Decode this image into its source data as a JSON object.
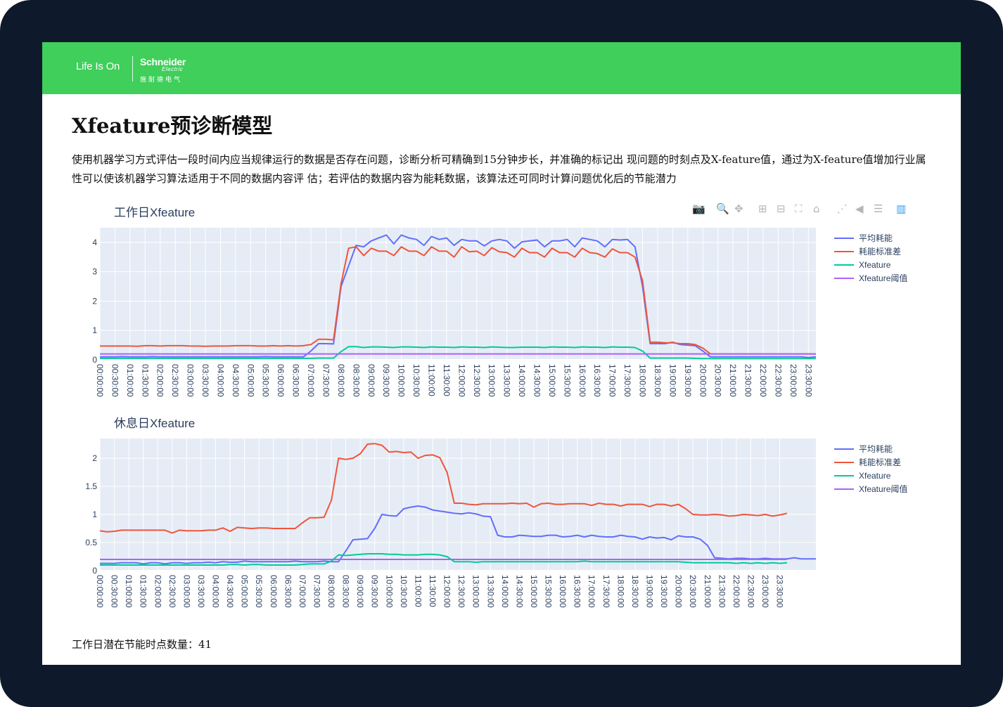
{
  "logo": {
    "tagline": "Life Is On",
    "brand": "Schneider",
    "brand_sub": "Electric",
    "brand_cn": "施耐德电气"
  },
  "page": {
    "title": "Xfeature预诊断模型",
    "description": "使用机器学习方式评估一段时间内应当规律运行的数据是否存在问题，诊断分析可精确到15分钟步长，并准确的标记出 现问题的时刻点及X-feature值，通过为X-feature值增加行业属性可以使该机器学习算法适用于不同的数据内容评 估；若评估的数据内容为能耗数据，该算法还可同时计算问题优化后的节能潜力",
    "footer_label": "工作日潜在节能时点数量：",
    "footer_value": "41"
  },
  "modebar": [
    {
      "icon": "camera-icon",
      "glyph": "📷"
    },
    {
      "icon": "zoom-icon",
      "glyph": "🔍"
    },
    {
      "icon": "pan-icon",
      "glyph": "✥"
    },
    {
      "icon": "zoom-in-icon",
      "glyph": "⊞"
    },
    {
      "icon": "zoom-out-icon",
      "glyph": "⊟"
    },
    {
      "icon": "autoscale-icon",
      "glyph": "⛶"
    },
    {
      "icon": "reset-axes-icon",
      "glyph": "⌂"
    },
    {
      "icon": "spike-lines-icon",
      "glyph": "⋰"
    },
    {
      "icon": "hover-closest-icon",
      "glyph": "◀"
    },
    {
      "icon": "hover-compare-icon",
      "glyph": "☰"
    },
    {
      "icon": "plotly-logo-icon",
      "glyph": "▥"
    }
  ],
  "colors": {
    "avg": "#636efa",
    "std": "#ef553b",
    "xfeature": "#00cc96",
    "threshold": "#ab63fa",
    "plot_bg": "#e5ecf6",
    "banner": "#3fcf5a"
  },
  "chart_data": [
    {
      "type": "line",
      "title": "工作日Xfeature",
      "x_tick_labels": [
        "00:00:00",
        "00:30:00",
        "01:00:00",
        "01:30:00",
        "02:00:00",
        "02:30:00",
        "03:00:00",
        "03:30:00",
        "04:00:00",
        "04:30:00",
        "05:00:00",
        "05:30:00",
        "06:00:00",
        "06:30:00",
        "07:00:00",
        "07:30:00",
        "08:00:00",
        "08:30:00",
        "09:00:00",
        "09:30:00",
        "10:00:00",
        "10:30:00",
        "11:00:00",
        "11:30:00",
        "12:00:00",
        "12:30:00",
        "13:00:00",
        "13:30:00",
        "14:00:00",
        "14:30:00",
        "15:00:00",
        "15:30:00",
        "16:00:00",
        "16:30:00",
        "17:00:00",
        "17:30:00",
        "18:00:00",
        "18:30:00",
        "19:00:00",
        "19:30:00",
        "20:00:00",
        "20:30:00",
        "21:00:00",
        "21:30:00",
        "22:00:00",
        "22:30:00",
        "23:00:00",
        "23:30:00"
      ],
      "x_step_minutes": 15,
      "ylim": [
        0,
        4.5
      ],
      "y_ticks": [
        0,
        1,
        2,
        3,
        4
      ],
      "y_tick_labels": [
        "0",
        "1",
        "2",
        "3",
        "4"
      ],
      "legend_position": "right",
      "series": [
        {
          "name": "平均耗能",
          "color_key": "avg",
          "values": [
            0.1,
            0.1,
            0.1,
            0.11,
            0.1,
            0.1,
            0.1,
            0.11,
            0.1,
            0.1,
            0.1,
            0.1,
            0.1,
            0.1,
            0.1,
            0.1,
            0.1,
            0.1,
            0.1,
            0.1,
            0.1,
            0.1,
            0.11,
            0.1,
            0.1,
            0.1,
            0.1,
            0.1,
            0.3,
            0.55,
            0.55,
            0.54,
            2.5,
            3.2,
            3.9,
            3.85,
            4.05,
            4.15,
            4.25,
            3.95,
            4.25,
            4.15,
            4.1,
            3.9,
            4.2,
            4.1,
            4.15,
            3.9,
            4.1,
            4.05,
            4.05,
            3.88,
            4.05,
            4.1,
            4.05,
            3.8,
            4.02,
            4.05,
            4.08,
            3.85,
            4.05,
            4.05,
            4.1,
            3.85,
            4.15,
            4.1,
            4.05,
            3.85,
            4.1,
            4.08,
            4.1,
            3.85,
            2.5,
            0.55,
            0.55,
            0.55,
            0.6,
            0.52,
            0.5,
            0.48,
            0.3,
            0.1,
            0.1,
            0.1,
            0.1,
            0.1,
            0.1,
            0.1,
            0.1,
            0.1,
            0.1,
            0.1,
            0.1,
            0.1,
            0.08,
            0.1
          ]
        },
        {
          "name": "耗能标准差",
          "color_key": "std",
          "values": [
            0.47,
            0.47,
            0.47,
            0.47,
            0.47,
            0.46,
            0.48,
            0.48,
            0.47,
            0.48,
            0.48,
            0.48,
            0.47,
            0.47,
            0.46,
            0.47,
            0.47,
            0.47,
            0.48,
            0.48,
            0.48,
            0.47,
            0.47,
            0.48,
            0.47,
            0.48,
            0.47,
            0.48,
            0.52,
            0.7,
            0.7,
            0.68,
            2.6,
            3.8,
            3.85,
            3.55,
            3.8,
            3.7,
            3.7,
            3.55,
            3.85,
            3.7,
            3.7,
            3.55,
            3.85,
            3.7,
            3.7,
            3.5,
            3.85,
            3.68,
            3.7,
            3.55,
            3.82,
            3.68,
            3.65,
            3.5,
            3.8,
            3.65,
            3.65,
            3.5,
            3.8,
            3.65,
            3.65,
            3.5,
            3.8,
            3.65,
            3.62,
            3.5,
            3.78,
            3.65,
            3.65,
            3.5,
            2.7,
            0.6,
            0.6,
            0.58,
            0.58,
            0.55,
            0.55,
            0.52,
            0.4,
            0.2,
            0.2,
            0.2,
            0.2,
            0.2,
            0.2,
            0.2,
            0.2,
            0.2,
            0.2,
            0.2,
            0.2,
            0.2,
            0.2,
            0.2
          ]
        },
        {
          "name": "Xfeature",
          "color_key": "xfeature",
          "values": [
            0.05,
            0.05,
            0.05,
            0.05,
            0.05,
            0.05,
            0.05,
            0.05,
            0.05,
            0.05,
            0.05,
            0.05,
            0.05,
            0.05,
            0.05,
            0.05,
            0.05,
            0.05,
            0.05,
            0.05,
            0.05,
            0.05,
            0.05,
            0.05,
            0.05,
            0.05,
            0.05,
            0.05,
            0.05,
            0.06,
            0.06,
            0.06,
            0.28,
            0.45,
            0.45,
            0.42,
            0.44,
            0.44,
            0.43,
            0.42,
            0.44,
            0.44,
            0.43,
            0.42,
            0.44,
            0.43,
            0.43,
            0.42,
            0.44,
            0.43,
            0.43,
            0.42,
            0.44,
            0.43,
            0.42,
            0.42,
            0.43,
            0.43,
            0.43,
            0.42,
            0.44,
            0.43,
            0.43,
            0.42,
            0.44,
            0.43,
            0.43,
            0.42,
            0.44,
            0.43,
            0.43,
            0.42,
            0.3,
            0.06,
            0.06,
            0.06,
            0.06,
            0.06,
            0.06,
            0.05,
            0.04,
            0.04,
            0.04,
            0.04,
            0.04,
            0.04,
            0.04,
            0.04,
            0.04,
            0.04,
            0.04,
            0.04,
            0.04,
            0.04,
            0.04,
            0.04
          ]
        },
        {
          "name": "Xfeature阈值",
          "color_key": "threshold",
          "values": [
            0.2,
            0.2,
            0.2,
            0.2,
            0.2,
            0.2,
            0.2,
            0.2,
            0.2,
            0.2,
            0.2,
            0.2,
            0.2,
            0.2,
            0.2,
            0.2,
            0.2,
            0.2,
            0.2,
            0.2,
            0.2,
            0.2,
            0.2,
            0.2,
            0.2,
            0.2,
            0.2,
            0.2,
            0.2,
            0.2,
            0.2,
            0.2,
            0.2,
            0.2,
            0.2,
            0.2,
            0.2,
            0.2,
            0.2,
            0.2,
            0.2,
            0.2,
            0.2,
            0.2,
            0.2,
            0.2,
            0.2,
            0.2,
            0.2,
            0.2,
            0.2,
            0.2,
            0.2,
            0.2,
            0.2,
            0.2,
            0.2,
            0.2,
            0.2,
            0.2,
            0.2,
            0.2,
            0.2,
            0.2,
            0.2,
            0.2,
            0.2,
            0.2,
            0.2,
            0.2,
            0.2,
            0.2,
            0.2,
            0.2,
            0.2,
            0.2,
            0.2,
            0.2,
            0.2,
            0.2,
            0.2,
            0.2,
            0.2,
            0.2,
            0.2,
            0.2,
            0.2,
            0.2,
            0.2,
            0.2,
            0.2,
            0.2,
            0.2,
            0.2,
            0.2,
            0.2
          ]
        }
      ]
    },
    {
      "type": "line",
      "title": "休息日Xfeature",
      "x_tick_labels": [
        "00:00:00",
        "00:30:00",
        "01:00:00",
        "01:30:00",
        "02:00:00",
        "02:30:00",
        "03:00:00",
        "03:30:00",
        "04:00:00",
        "04:30:00",
        "05:00:00",
        "05:30:00",
        "06:00:00",
        "06:30:00",
        "07:00:00",
        "07:30:00",
        "08:00:00",
        "08:30:00",
        "09:00:00",
        "09:30:00",
        "10:00:00",
        "10:30:00",
        "11:00:00",
        "11:30:00",
        "12:00:00",
        "12:30:00",
        "13:00:00",
        "13:30:00",
        "14:00:00",
        "14:30:00",
        "15:00:00",
        "15:30:00",
        "16:00:00",
        "16:30:00",
        "17:00:00",
        "17:30:00",
        "18:00:00",
        "18:30:00",
        "19:00:00",
        "19:30:00",
        "20:00:00",
        "20:30:00",
        "21:00:00",
        "21:30:00",
        "22:00:00",
        "22:30:00",
        "23:00:00",
        "23:30:00"
      ],
      "x_step_minutes": 15,
      "ylim": [
        0,
        2.35
      ],
      "y_ticks": [
        0,
        0.5,
        1,
        1.5,
        2
      ],
      "y_tick_labels": [
        "0",
        "0.5",
        "1",
        "1.5",
        "2"
      ],
      "legend_position": "right",
      "series": [
        {
          "name": "平均耗能",
          "color_key": "avg",
          "values": [
            0.13,
            0.13,
            0.13,
            0.14,
            0.14,
            0.14,
            0.12,
            0.14,
            0.14,
            0.12,
            0.14,
            0.14,
            0.13,
            0.14,
            0.14,
            0.15,
            0.14,
            0.16,
            0.15,
            0.15,
            0.17,
            0.16,
            0.16,
            0.16,
            0.16,
            0.16,
            0.16,
            0.17,
            0.16,
            0.16,
            0.16,
            0.17,
            0.16,
            0.16,
            0.35,
            0.55,
            0.56,
            0.57,
            0.75,
            1.0,
            0.98,
            0.97,
            1.1,
            1.13,
            1.15,
            1.13,
            1.08,
            1.06,
            1.04,
            1.02,
            1.01,
            1.03,
            1.01,
            0.97,
            0.96,
            0.63,
            0.6,
            0.6,
            0.63,
            0.62,
            0.61,
            0.61,
            0.63,
            0.63,
            0.6,
            0.61,
            0.63,
            0.6,
            0.63,
            0.61,
            0.6,
            0.6,
            0.63,
            0.61,
            0.6,
            0.56,
            0.6,
            0.58,
            0.59,
            0.55,
            0.62,
            0.6,
            0.6,
            0.56,
            0.45,
            0.23,
            0.22,
            0.21,
            0.22,
            0.22,
            0.21,
            0.21,
            0.22,
            0.21,
            0.21,
            0.21,
            0.23,
            0.21,
            0.21,
            0.21
          ]
        },
        {
          "name": "耗能标准差",
          "color_key": "std",
          "values": [
            0.71,
            0.69,
            0.7,
            0.72,
            0.72,
            0.72,
            0.72,
            0.72,
            0.72,
            0.72,
            0.67,
            0.72,
            0.71,
            0.71,
            0.71,
            0.72,
            0.72,
            0.76,
            0.7,
            0.77,
            0.76,
            0.75,
            0.76,
            0.76,
            0.75,
            0.75,
            0.75,
            0.75,
            0.85,
            0.94,
            0.94,
            0.95,
            1.25,
            2.0,
            1.98,
            2.0,
            2.08,
            2.25,
            2.26,
            2.23,
            2.11,
            2.12,
            2.1,
            2.11,
            2.0,
            2.05,
            2.06,
            2.01,
            1.75,
            1.2,
            1.2,
            1.18,
            1.17,
            1.19,
            1.19,
            1.19,
            1.19,
            1.2,
            1.19,
            1.2,
            1.13,
            1.19,
            1.2,
            1.18,
            1.18,
            1.19,
            1.19,
            1.19,
            1.16,
            1.2,
            1.18,
            1.18,
            1.15,
            1.18,
            1.18,
            1.18,
            1.14,
            1.18,
            1.18,
            1.15,
            1.18,
            1.1,
            1.0,
            0.99,
            0.99,
            1.0,
            0.99,
            0.97,
            0.98,
            1.0,
            0.99,
            0.98,
            1.0,
            0.97,
            0.99,
            1.02
          ]
        },
        {
          "name": "Xfeature",
          "color_key": "xfeature",
          "values": [
            0.1,
            0.1,
            0.1,
            0.1,
            0.1,
            0.1,
            0.1,
            0.1,
            0.1,
            0.1,
            0.1,
            0.1,
            0.1,
            0.1,
            0.1,
            0.1,
            0.1,
            0.1,
            0.11,
            0.11,
            0.1,
            0.11,
            0.11,
            0.1,
            0.1,
            0.1,
            0.1,
            0.1,
            0.11,
            0.12,
            0.12,
            0.12,
            0.17,
            0.28,
            0.27,
            0.28,
            0.29,
            0.3,
            0.3,
            0.3,
            0.29,
            0.29,
            0.28,
            0.28,
            0.28,
            0.29,
            0.29,
            0.28,
            0.25,
            0.16,
            0.16,
            0.16,
            0.15,
            0.16,
            0.16,
            0.16,
            0.16,
            0.16,
            0.16,
            0.16,
            0.16,
            0.16,
            0.16,
            0.16,
            0.16,
            0.16,
            0.16,
            0.17,
            0.16,
            0.16,
            0.16,
            0.16,
            0.16,
            0.16,
            0.16,
            0.16,
            0.16,
            0.16,
            0.16,
            0.16,
            0.16,
            0.15,
            0.14,
            0.14,
            0.14,
            0.14,
            0.14,
            0.14,
            0.13,
            0.14,
            0.13,
            0.14,
            0.13,
            0.14,
            0.13,
            0.14
          ]
        },
        {
          "name": "Xfeature阈值",
          "color_key": "threshold",
          "values": [
            0.2,
            0.2,
            0.2,
            0.2,
            0.2,
            0.2,
            0.2,
            0.2,
            0.2,
            0.2,
            0.2,
            0.2,
            0.2,
            0.2,
            0.2,
            0.2,
            0.2,
            0.2,
            0.2,
            0.2,
            0.2,
            0.2,
            0.2,
            0.2,
            0.2,
            0.2,
            0.2,
            0.2,
            0.2,
            0.2,
            0.2,
            0.2,
            0.2,
            0.2,
            0.2,
            0.2,
            0.2,
            0.2,
            0.2,
            0.2,
            0.2,
            0.2,
            0.2,
            0.2,
            0.2,
            0.2,
            0.2,
            0.2,
            0.2,
            0.2,
            0.2,
            0.2,
            0.2,
            0.2,
            0.2,
            0.2,
            0.2,
            0.2,
            0.2,
            0.2,
            0.2,
            0.2,
            0.2,
            0.2,
            0.2,
            0.2,
            0.2,
            0.2,
            0.2,
            0.2,
            0.2,
            0.2,
            0.2,
            0.2,
            0.2,
            0.2,
            0.2,
            0.2,
            0.2,
            0.2,
            0.2,
            0.2,
            0.2,
            0.2,
            0.2,
            0.2,
            0.2,
            0.2,
            0.2,
            0.2,
            0.2,
            0.2,
            0.2,
            0.2,
            0.2,
            0.2
          ]
        }
      ]
    }
  ]
}
